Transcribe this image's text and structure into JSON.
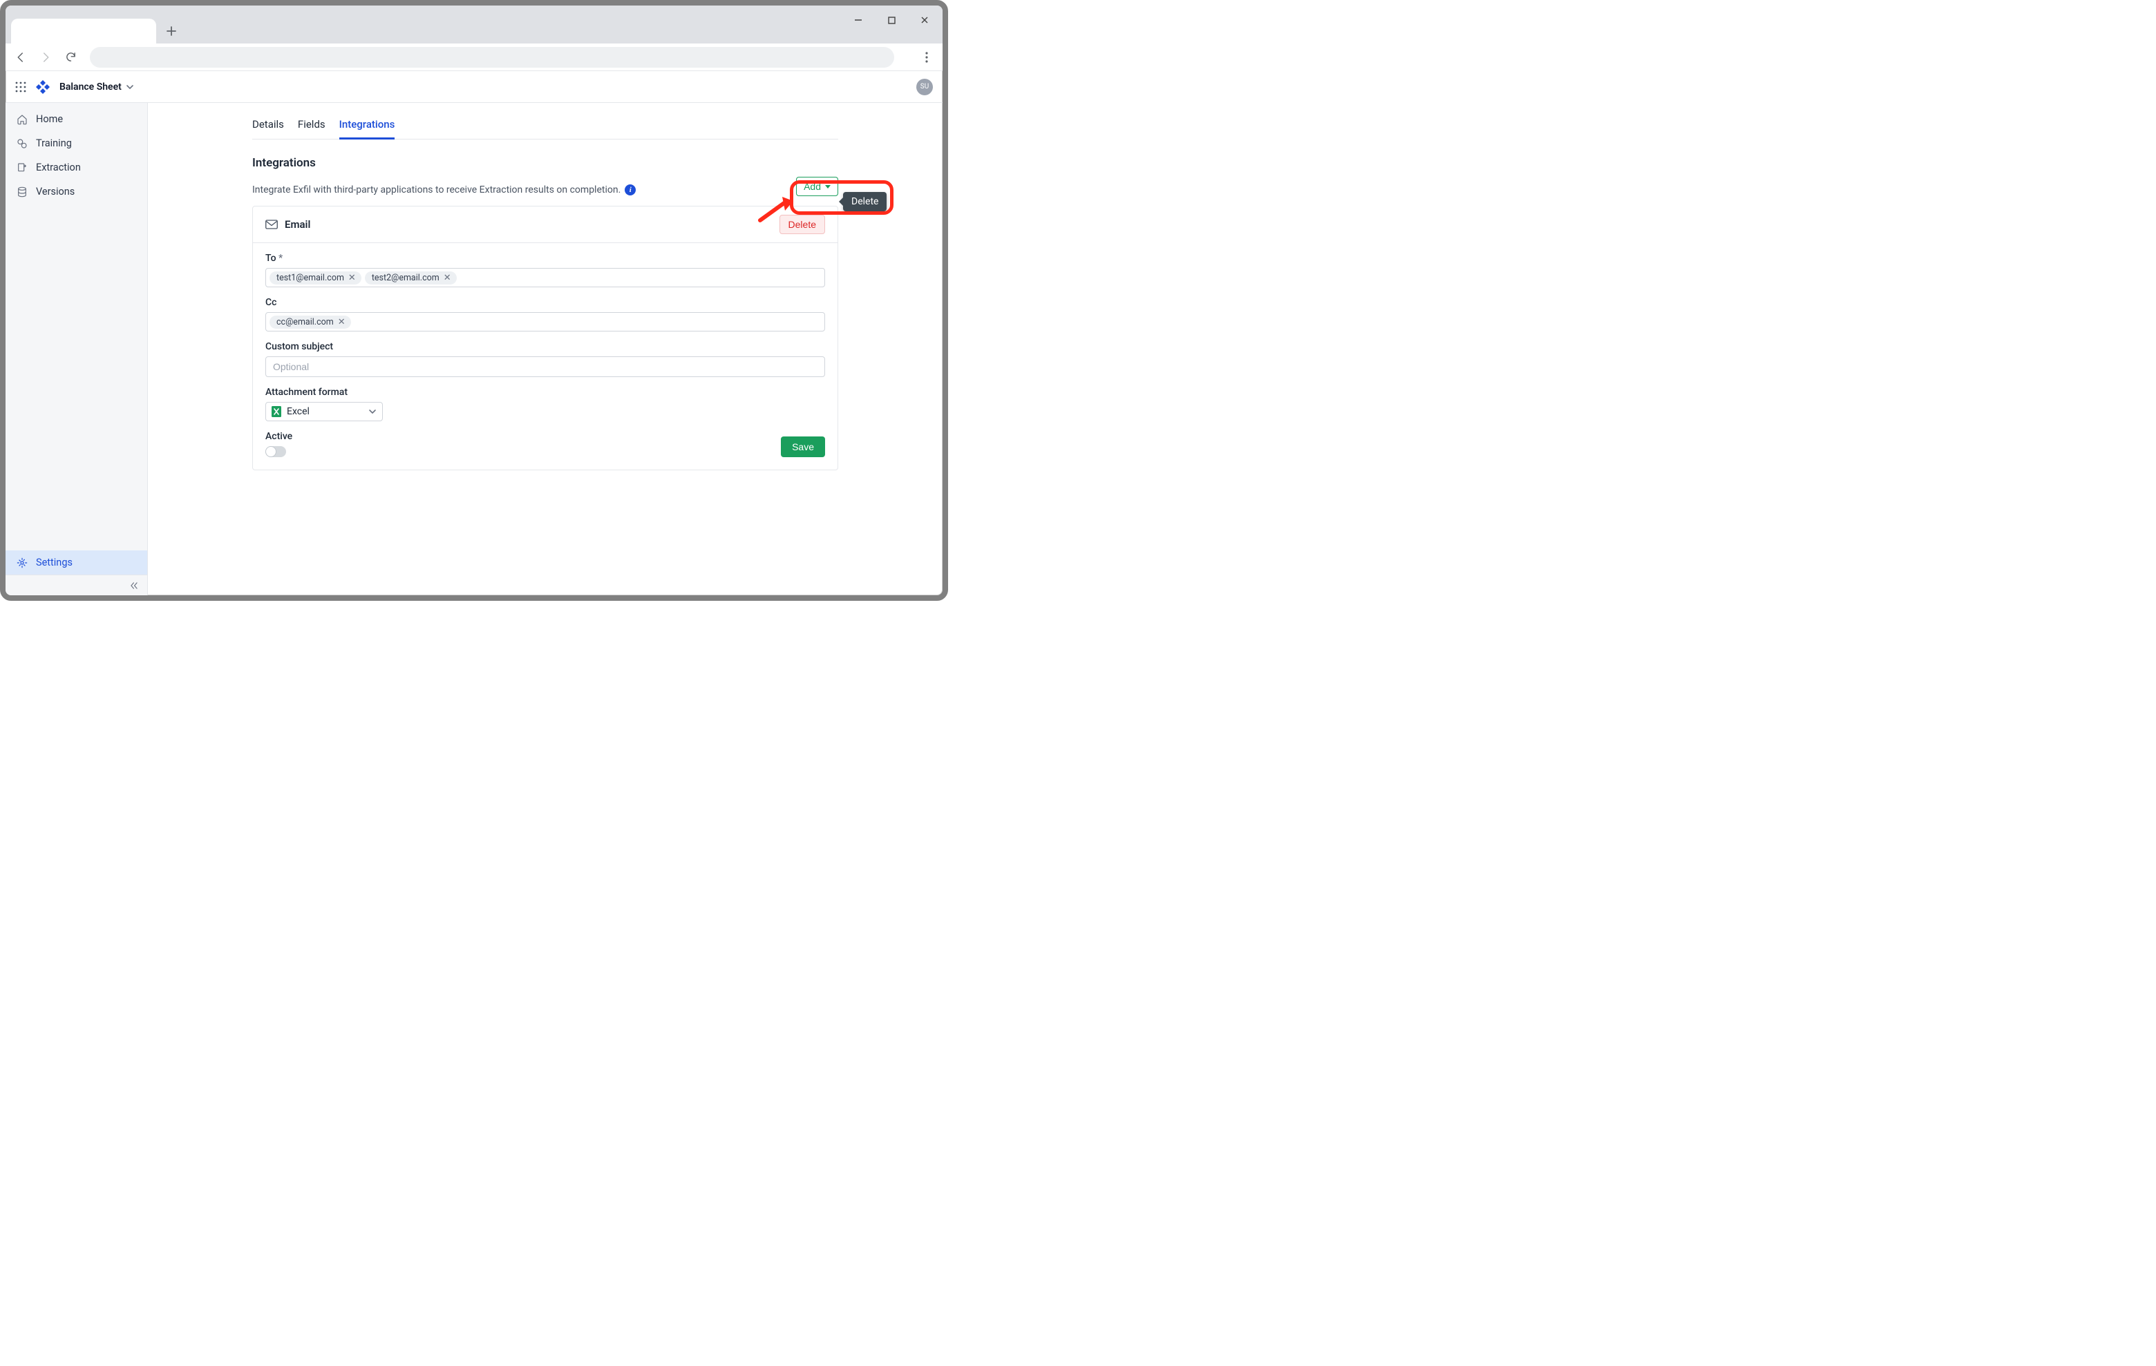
{
  "header": {
    "project_name": "Balance Sheet",
    "avatar_initials": "SU"
  },
  "sidebar": {
    "items": [
      {
        "label": "Home"
      },
      {
        "label": "Training"
      },
      {
        "label": "Extraction"
      },
      {
        "label": "Versions"
      }
    ],
    "footer_item": {
      "label": "Settings"
    }
  },
  "tabs": [
    {
      "label": "Details"
    },
    {
      "label": "Fields"
    },
    {
      "label": "Integrations",
      "active": true
    }
  ],
  "section": {
    "title": "Integrations",
    "description": "Integrate Exfil with third-party applications to receive Extraction results on completion.",
    "add_button": "Add"
  },
  "email_card": {
    "title": "Email",
    "delete_button": "Delete",
    "delete_tooltip": "Delete",
    "fields": {
      "to_label": "To",
      "to_required_marker": "*",
      "to_chips": [
        "test1@email.com",
        "test2@email.com"
      ],
      "cc_label": "Cc",
      "cc_chips": [
        "cc@email.com"
      ],
      "subject_label": "Custom subject",
      "subject_placeholder": "Optional",
      "subject_value": "",
      "format_label": "Attachment format",
      "format_value": "Excel",
      "active_label": "Active",
      "active_checked": false
    },
    "save_button": "Save"
  }
}
